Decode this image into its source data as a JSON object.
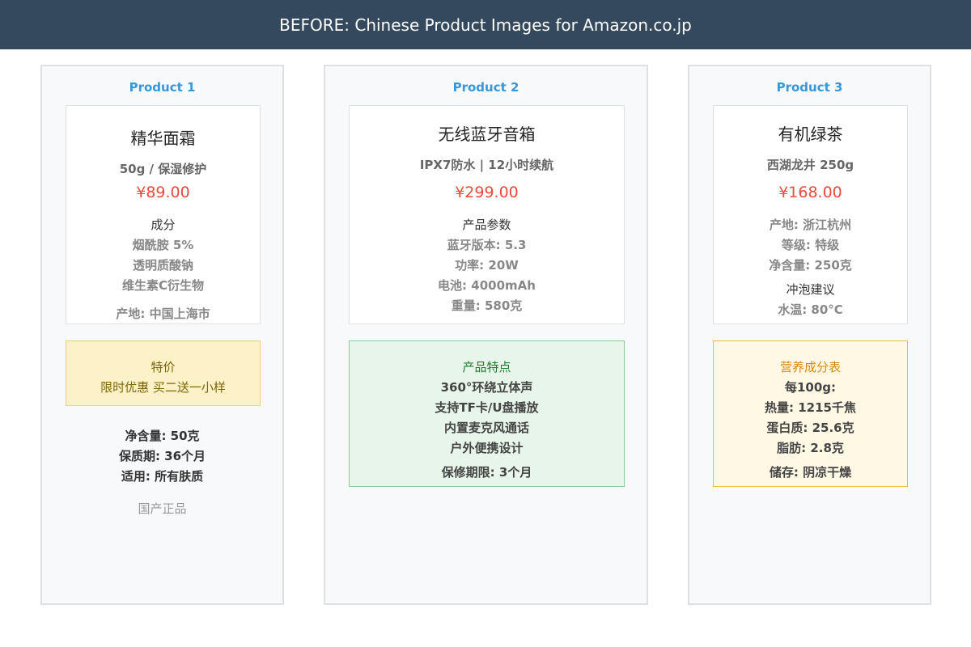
{
  "header": {
    "title": "BEFORE: Chinese Product Images for Amazon.co.jp"
  },
  "products": [
    {
      "label": "Product 1",
      "name": "精华面霜",
      "subtitle": "50g / 保湿修护",
      "price": "¥89.00",
      "section_heading": "成分",
      "details": [
        "烟酰胺 5%",
        "透明质酸钠",
        "维生素C衍生物"
      ],
      "footer_detail": "产地: 中国上海市",
      "callout": {
        "title": "特价",
        "lines": [
          "限时优惠 买二送一小样"
        ]
      },
      "extra_lines": [
        "净含量: 50克",
        "保质期: 36个月",
        "适用: 所有肤质"
      ],
      "muted_note": "国产正品"
    },
    {
      "label": "Product 2",
      "name": "无线蓝牙音箱",
      "subtitle": "IPX7防水 | 12小时续航",
      "price": "¥299.00",
      "section_heading": "产品参数",
      "details": [
        "蓝牙版本: 5.3",
        "功率: 20W",
        "电池: 4000mAh",
        "重量: 580克"
      ],
      "callout": {
        "title": "产品特点",
        "lines": [
          "360°环绕立体声",
          "支持TF卡/U盘播放",
          "内置麦克风通话",
          "户外便携设计"
        ],
        "footer": "保修期限: 3个月"
      }
    },
    {
      "label": "Product 3",
      "name": "有机绿茶",
      "subtitle": "西湖龙井 250g",
      "price": "¥168.00",
      "details": [
        "产地: 浙江杭州",
        "等级: 特级",
        "净含量: 250克"
      ],
      "section_heading": "冲泡建议",
      "tail_detail": "水温: 80°C",
      "callout": {
        "title": "营养成分表",
        "lines": [
          "每100g:",
          "热量: 1215千焦",
          "蛋白质: 25.6克",
          "脂肪: 2.8克"
        ],
        "footer": "储存: 阴凉干燥"
      }
    }
  ]
}
